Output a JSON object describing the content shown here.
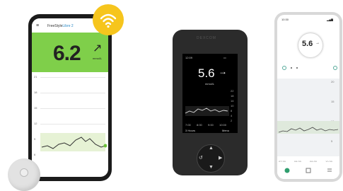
{
  "colors": {
    "green_zone": "#7fcf4a",
    "wifi_badge": "#f6c51d",
    "receiver_body": "#2b2b2b"
  },
  "phone1": {
    "app_title_prefix": "FreeStyle",
    "app_title_accent": "Libre 2",
    "glucose": "6.2",
    "trend_arrow": "↗",
    "unit": "mmol/L",
    "y_labels": [
      "21",
      "18",
      "15",
      "12",
      "9",
      "6",
      "3"
    ]
  },
  "receiver": {
    "brand": "DEXCOM",
    "time": "12:09",
    "glucose": "5.6",
    "trend_arrow": "→",
    "unit": "mmol/L",
    "y_labels": [
      "22",
      "18",
      "14",
      "10",
      "8",
      "4",
      "2"
    ],
    "x_labels": [
      "7:00",
      "8:00",
      "9:00",
      "10:00"
    ],
    "footer_left": "3 Hours",
    "footer_right": "Menu"
  },
  "phone2": {
    "status_time": "10:30",
    "glucose": "5.6",
    "trend_arrow": "→",
    "y_labels": [
      "20",
      "15",
      "10",
      "5"
    ],
    "x_labels": [
      "07:30",
      "08:30",
      "09:30",
      "10:30"
    ]
  }
}
